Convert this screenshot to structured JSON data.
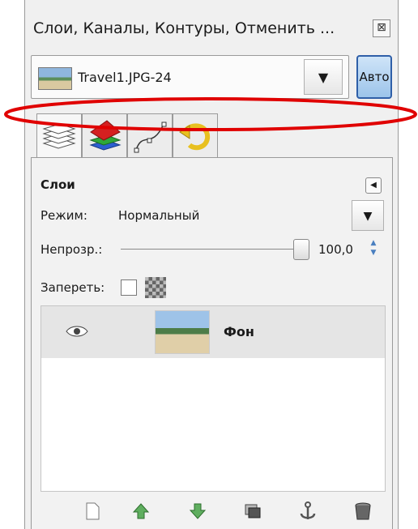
{
  "window": {
    "title": "Слои, Каналы, Контуры, Отменить ...",
    "close_icon": "close-icon"
  },
  "image_selector": {
    "name": "Travel1.JPG-24",
    "dropdown_icon": "chevron-down-icon",
    "auto_label": "Авто"
  },
  "tabs": [
    {
      "icon": "layers-icon"
    },
    {
      "icon": "channels-icon"
    },
    {
      "icon": "paths-icon"
    },
    {
      "icon": "undo-history-icon"
    }
  ],
  "layers_panel": {
    "heading": "Слои",
    "mode_label": "Режим:",
    "mode_value": "Нормальный",
    "opacity_label": "Непрозр.:",
    "opacity_value": "100,0",
    "lock_label": "Запереть:"
  },
  "layer_list": [
    {
      "name": "Фон",
      "visible": true
    }
  ],
  "bottom_buttons": [
    {
      "icon": "new-layer-icon"
    },
    {
      "icon": "raise-layer-icon"
    },
    {
      "icon": "lower-layer-icon"
    },
    {
      "icon": "duplicate-layer-icon"
    },
    {
      "icon": "anchor-layer-icon"
    },
    {
      "icon": "delete-layer-icon"
    }
  ],
  "colors": {
    "annotation_ring": "#e00000",
    "auto_button": "#9cc4ea",
    "selected_row": "#e5e5e5"
  }
}
